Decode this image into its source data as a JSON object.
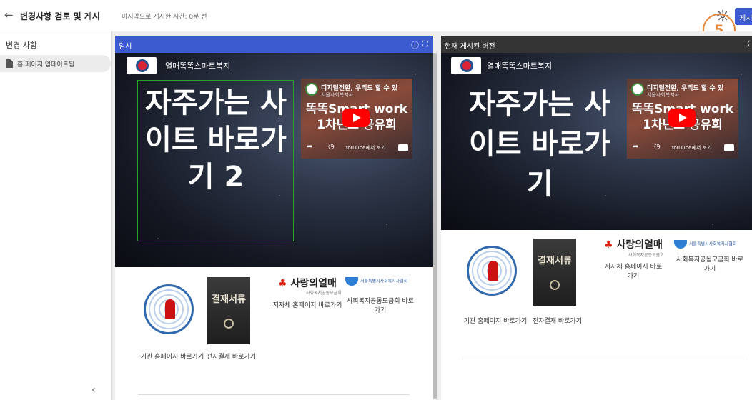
{
  "header": {
    "back_icon": "arrow-left-icon",
    "title": "변경사항 검토 및 게시",
    "last_published": "마지막으로 게시한 시간: 0분 전",
    "settings_icon": "gear-icon",
    "publish_label": "게시",
    "step_badge": "5",
    "accent_color": "#3c5bd0",
    "badge_color": "#e7883a"
  },
  "sidebar": {
    "title": "변경 사항",
    "items": [
      {
        "label": "홈 페이지 업데이트됨",
        "icon": "document-icon"
      }
    ],
    "collapse_label": "‹"
  },
  "panels": {
    "draft": {
      "title": "임시",
      "header_color": "#3c5bd0",
      "site_name": "열매똑똑스마트복지",
      "hero_text": "자주가는 사이트 바로가기 2",
      "video": {
        "title": "디지털전환, 우리도 할 수 있",
        "channel": "서울사회복지사",
        "line1": "똑똑Smart work",
        "line2": "1차년도 공유회",
        "watch_on": "YouTube에서 보기"
      },
      "links": [
        {
          "label": "기관 홈페이지 바로가기"
        },
        {
          "label": "전자결재 바로가기",
          "image_text": "결재서류"
        },
        {
          "label": "지자체 홈페이지 바로가기",
          "logo_text": "사랑의열매",
          "logo_sub": "사회복지공동모금회"
        },
        {
          "label": "사회복지공동모금회 바로가기",
          "logo_text": "서울특별시사회복지사협회"
        }
      ]
    },
    "live": {
      "title": "현재 게시된 버전",
      "header_color": "#343434",
      "site_name": "열매똑똑스마트복지",
      "hero_text": "자주가는 사이트 바로가기",
      "video": {
        "title": "디지털전환, 우리도 할 수 있",
        "channel": "서울사회복지사",
        "line1": "똑똑Smart work",
        "line2": "1차년도 공유회",
        "watch_on": "YouTube에서 보기"
      },
      "links": [
        {
          "label": "기관 홈페이지 바로가기"
        },
        {
          "label": "전자결재 바로가기",
          "image_text": "결재서류"
        },
        {
          "label": "지자체 홈페이지 바로가기",
          "logo_text": "사랑의열매",
          "logo_sub": "사회복지공동모금회"
        },
        {
          "label": "사회복지공동모금회 바로가기",
          "logo_text": "서울특별시사회복지사협회"
        }
      ]
    }
  }
}
